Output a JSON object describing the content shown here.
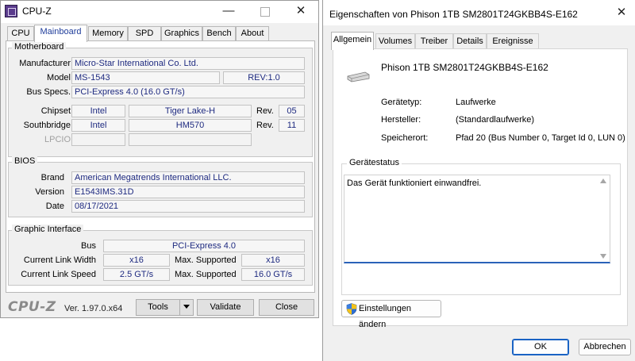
{
  "cpuz": {
    "title": "CPU-Z",
    "tabs": [
      "CPU",
      "Mainboard",
      "Memory",
      "SPD",
      "Graphics",
      "Bench",
      "About"
    ],
    "active_tab": "Mainboard",
    "motherboard": {
      "group_title": "Motherboard",
      "manufacturer_label": "Manufacturer",
      "manufacturer": "Micro-Star International Co. Ltd.",
      "model_label": "Model",
      "model": "MS-1543",
      "revision": "REV:1.0",
      "bus_specs_label": "Bus Specs.",
      "bus_specs": "PCI-Express 4.0 (16.0 GT/s)",
      "chipset_label": "Chipset",
      "chipset_vendor": "Intel",
      "chipset_name": "Tiger Lake-H",
      "rev_label": "Rev.",
      "chipset_rev": "05",
      "southbridge_label": "Southbridge",
      "southbridge_vendor": "Intel",
      "southbridge_name": "HM570",
      "southbridge_rev": "11",
      "lpcio_label": "LPCIO"
    },
    "bios": {
      "group_title": "BIOS",
      "brand_label": "Brand",
      "brand": "American Megatrends International LLC.",
      "version_label": "Version",
      "version": "E1543IMS.31D",
      "date_label": "Date",
      "date": "08/17/2021"
    },
    "graphic_interface": {
      "group_title": "Graphic Interface",
      "bus_label": "Bus",
      "bus": "PCI-Express 4.0",
      "link_width_label": "Current Link Width",
      "link_width": "x16",
      "max_supported_label": "Max. Supported",
      "max_link_width": "x16",
      "link_speed_label": "Current Link Speed",
      "link_speed": "2.5 GT/s",
      "max_link_speed": "16.0 GT/s"
    },
    "footer": {
      "logo": "CPU-Z",
      "version": "Ver. 1.97.0.x64",
      "tools_label": "Tools",
      "validate_label": "Validate",
      "close_label": "Close"
    },
    "title_buttons": {
      "minimize": "—",
      "close": "✕"
    }
  },
  "properties": {
    "title": "Eigenschaften von Phison 1TB SM2801T24GKBB4S-E162",
    "close": "✕",
    "tabs": [
      "Allgemein",
      "Volumes",
      "Treiber",
      "Details",
      "Ereignisse"
    ],
    "active_tab": "Allgemein",
    "device_name": "Phison 1TB SM2801T24GKBB4S-E162",
    "device_type_label": "Gerätetyp:",
    "device_type": "Laufwerke",
    "manufacturer_label": "Hersteller:",
    "manufacturer": "(Standardlaufwerke)",
    "location_label": "Speicherort:",
    "location": "Pfad 20 (Bus Number 0, Target Id 0, LUN 0)",
    "status_group_title": "Gerätestatus",
    "status_text": "Das Gerät funktioniert einwandfrei.",
    "settings_button": "Einstellungen ändern",
    "ok_label": "OK",
    "cancel_label": "Abbrechen"
  },
  "colors": {
    "cpuz_value_text": "#1e2a80",
    "active_tab_text": "#1e3c9a",
    "ok_border": "#1a63c4"
  },
  "icons": [
    "cpuz-app-icon",
    "minimize-icon",
    "maximize-icon",
    "close-icon",
    "dropdown-arrow-icon",
    "drive-icon",
    "uac-shield-icon",
    "scroll-up-icon",
    "scroll-down-icon"
  ]
}
